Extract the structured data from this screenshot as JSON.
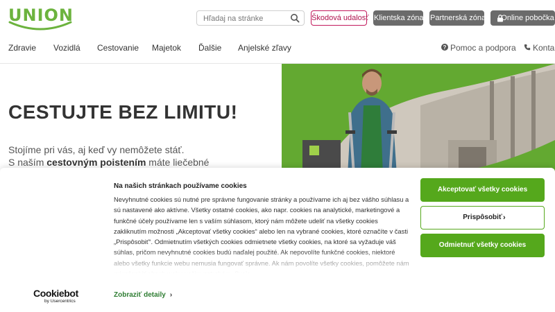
{
  "brand": {
    "logo_text": "UNION",
    "accent": "#6cb33e",
    "cta_green": "#55a81c",
    "alert_red": "#c2185b"
  },
  "header": {
    "search_placeholder": "Hľadaj na stránke",
    "buttons": {
      "claim": "Škodová udalosť",
      "client_zone": "Klientska zóna",
      "partner_zone": "Partnerská zóna",
      "online_branch": "Online pobočka"
    }
  },
  "nav": {
    "items": [
      "Zdravie",
      "Vozidlá",
      "Cestovanie",
      "Majetok",
      "Ďalšie",
      "Anjelské zľavy"
    ],
    "support": "Pomoc a podpora",
    "contact": "Kontakt"
  },
  "hero": {
    "title": "CESTUJTE BEZ LIMITU!",
    "text_line1": "Stojíme pri vás, aj keď vy nemôžete stáť.",
    "text_line2_prefix": "S naším ",
    "text_line2_bold": "cestovným poistením",
    "text_line2_suffix": " máte liečebné"
  },
  "cookie": {
    "title": "Na našich stránkach používame cookies",
    "body": "Nevyhnutné cookies sú nutné pre správne fungovanie stránky a používame ich aj bez vášho súhlasu a sú nastavené ako aktívne. Všetky ostatné cookies, ako napr. cookies na analytické, marketingové a funkčné účely používame len s vaším súhlasom, ktorý nám môžete udeliť na všetky cookies zakliknutím možnosti „Akceptovať všetky cookies“ alebo len na vybrané cookies, ktoré označíte v časti „Prispôsobiť“. Odmietnutím všetkých cookies odmietnete všetky cookies, na ktoré sa vyžaduje váš súhlas, pričom nevyhnutné cookies budú naďalej použité. Ak nepovolíte funkčné cookies, niektoré alebo všetky funkcie webu nemusia fungovať správne. Ak nám povolíte všetky cookies, pomôžete nám prispôsobiť obsah webu vašim potrebám. Svoje",
    "details_link": "Zobraziť detaily",
    "accept_all": "Akceptovať všetky cookies",
    "customize": "Prispôsobiť",
    "reject_all": "Odmietnuť všetky cookies",
    "provider_name": "Cookiebot",
    "provider_sub": "by Usercentrics"
  }
}
